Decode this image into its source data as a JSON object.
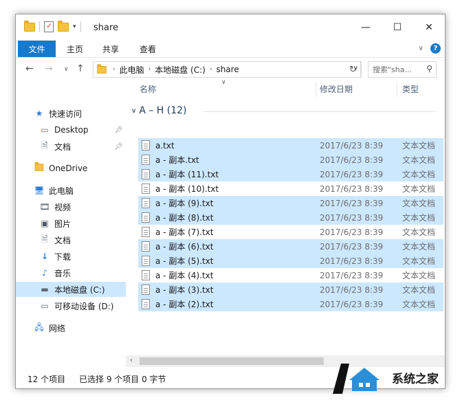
{
  "window": {
    "title": "share",
    "controls": {
      "minimize": "—",
      "maximize": "☐",
      "close": "✕"
    }
  },
  "ribbon": {
    "tabs": [
      "文件",
      "主页",
      "共享",
      "查看"
    ],
    "accent": "#1979ca"
  },
  "nav": {
    "breadcrumb": [
      "此电脑",
      "本地磁盘 (C:)",
      "share"
    ],
    "search_placeholder": "搜索\"sha..."
  },
  "sidebar": {
    "items": [
      {
        "label": "快速访问",
        "icon": "star-icon"
      },
      {
        "label": "Desktop",
        "icon": "desktop-icon"
      },
      {
        "label": "文档",
        "icon": "documents-icon"
      },
      {
        "label": "OneDrive",
        "icon": "folder-icon"
      },
      {
        "label": "此电脑",
        "icon": "computer-icon"
      },
      {
        "label": "视频",
        "icon": "video-icon"
      },
      {
        "label": "图片",
        "icon": "pictures-icon"
      },
      {
        "label": "文档",
        "icon": "documents-icon"
      },
      {
        "label": "下载",
        "icon": "download-icon"
      },
      {
        "label": "音乐",
        "icon": "music-icon"
      },
      {
        "label": "本地磁盘 (C:)",
        "icon": "drive-icon"
      },
      {
        "label": "可移动设备 (D:)",
        "icon": "removable-drive-icon"
      },
      {
        "label": "网络",
        "icon": "network-icon"
      }
    ],
    "selected_color": "#cce8ff"
  },
  "columns": {
    "name": "名称",
    "date": "修改日期",
    "type": "类型"
  },
  "group": {
    "label": "A – H (12)"
  },
  "files": [
    {
      "name": "a.txt",
      "date": "2017/6/23 8:39",
      "type": "文本文档",
      "selected": true
    },
    {
      "name": "a - 副本.txt",
      "date": "2017/6/23 8:39",
      "type": "文本文档",
      "selected": true
    },
    {
      "name": "a - 副本 (11).txt",
      "date": "2017/6/23 8:39",
      "type": "文本文档",
      "selected": true
    },
    {
      "name": "a - 副本 (10).txt",
      "date": "2017/6/23 8:39",
      "type": "文本文档",
      "selected": false
    },
    {
      "name": "a - 副本 (9).txt",
      "date": "2017/6/23 8:39",
      "type": "文本文档",
      "selected": true
    },
    {
      "name": "a - 副本 (8).txt",
      "date": "2017/6/23 8:39",
      "type": "文本文档",
      "selected": true
    },
    {
      "name": "a - 副本 (7).txt",
      "date": "2017/6/23 8:39",
      "type": "文本文档",
      "selected": false
    },
    {
      "name": "a - 副本 (6).txt",
      "date": "2017/6/23 8:39",
      "type": "文本文档",
      "selected": true
    },
    {
      "name": "a - 副本 (5).txt",
      "date": "2017/6/23 8:39",
      "type": "文本文档",
      "selected": true
    },
    {
      "name": "a - 副本 (4).txt",
      "date": "2017/6/23 8:39",
      "type": "文本文档",
      "selected": false
    },
    {
      "name": "a - 副本 (3).txt",
      "date": "2017/6/23 8:39",
      "type": "文本文档",
      "selected": true
    },
    {
      "name": "a - 副本 (2).txt",
      "date": "2017/6/23 8:39",
      "type": "文本文档",
      "selected": true
    }
  ],
  "status": {
    "count": "12 个项目",
    "selection": "已选择 9 个项目 0 字节"
  },
  "watermark": {
    "text": "系统之家"
  }
}
